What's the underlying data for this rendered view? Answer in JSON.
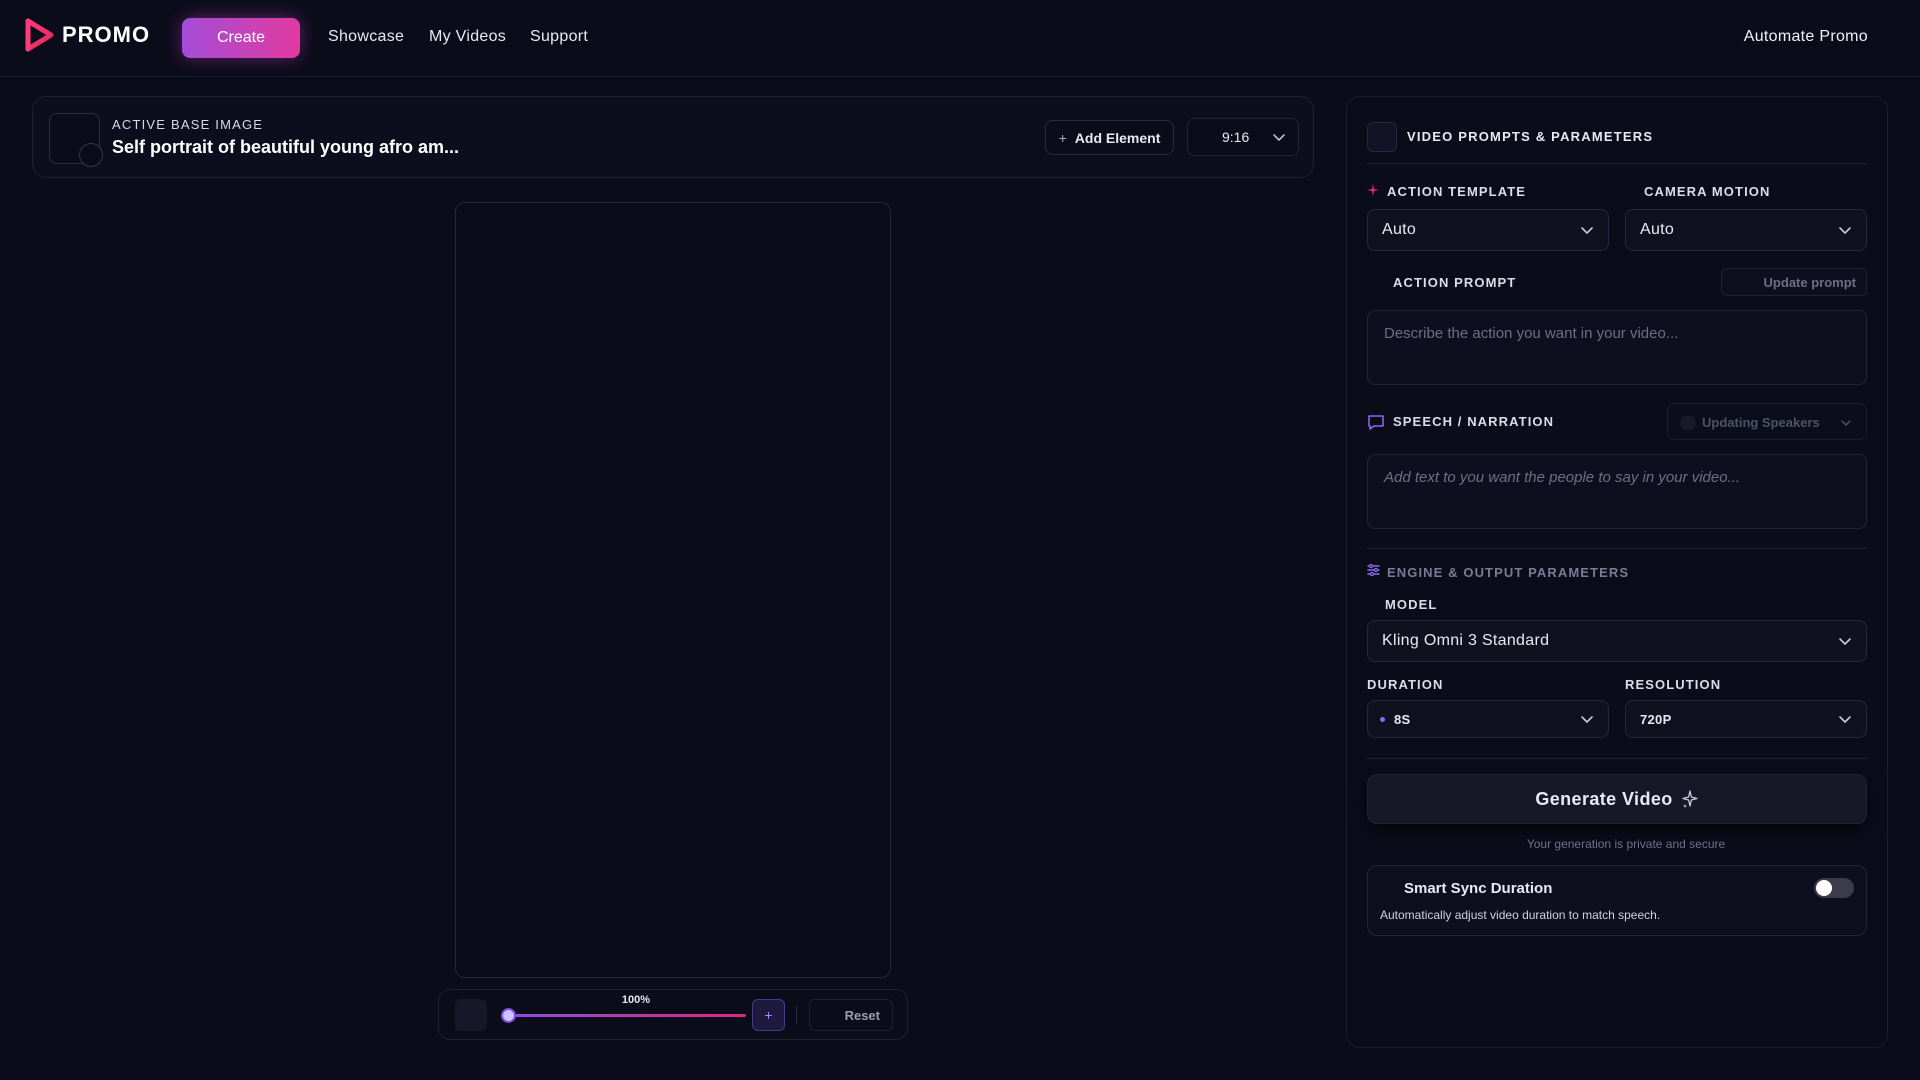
{
  "nav": {
    "logo_text": "PROMO",
    "create_label": "Create",
    "links": [
      "Showcase",
      "My Videos",
      "Support"
    ],
    "right_link": "Automate Promo"
  },
  "image_bar": {
    "label": "ACTIVE BASE IMAGE",
    "title": "Self portrait of beautiful young afro am...",
    "add_element_label": "Add Element",
    "aspect_ratio": "9:16"
  },
  "zoom": {
    "percent_label": "100%",
    "zoom_in_label": "+",
    "reset_label": "Reset"
  },
  "panel": {
    "header_title": "VIDEO PROMPTS & PARAMETERS",
    "action_template": {
      "label": "ACTION TEMPLATE",
      "value": "Auto"
    },
    "camera_motion": {
      "label": "CAMERA MOTION",
      "value": "Auto"
    },
    "action_prompt": {
      "label": "ACTION PROMPT",
      "update_label": "Update prompt",
      "placeholder": "Describe the action you want in your video..."
    },
    "speech": {
      "label": "SPEECH / NARRATION",
      "speakers_label": "Updating Speakers",
      "placeholder": "Add text to you want the people to say in your video..."
    },
    "engine": {
      "label": "ENGINE & OUTPUT PARAMETERS",
      "model_label": "MODEL",
      "model_value": "Kling Omni 3 Standard",
      "duration_label": "DURATION",
      "duration_value": "8S",
      "resolution_label": "RESOLUTION",
      "resolution_value": "720P"
    },
    "generate_label": "Generate Video",
    "privacy_note": "Your generation is private and secure",
    "smart_sync": {
      "title": "Smart Sync Duration",
      "description": "Automatically adjust video duration to match speech.",
      "enabled": false
    }
  },
  "colors": {
    "background": "#0b0c1a",
    "accent_gradient_start": "#a44dd8",
    "accent_gradient_end": "#e23aa0",
    "accent_purple": "#8a4de0",
    "accent_pink": "#e0287a"
  },
  "icons": {
    "logo": "play-logo-icon",
    "add": "plus-icon",
    "dropdown": "chevron-down-icon",
    "speech": "chat-bubble-icon",
    "engine": "sliders-icon",
    "action_template": "sparkle-icon",
    "generate": "sparkles-icon"
  }
}
